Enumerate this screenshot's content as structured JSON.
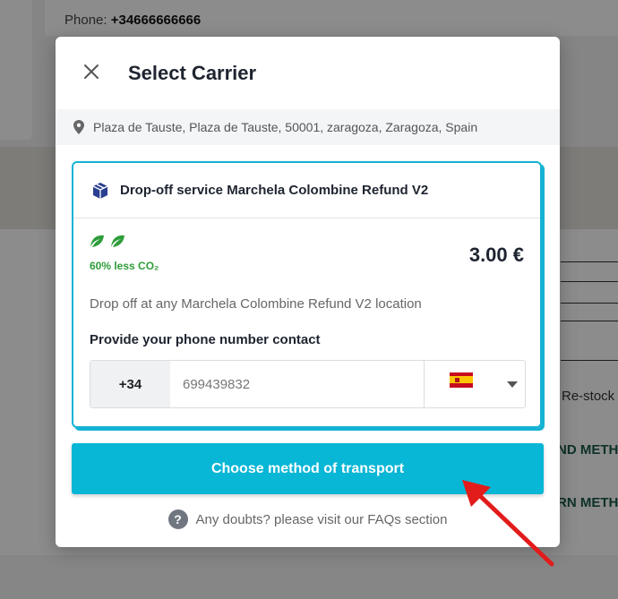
{
  "background": {
    "phone_label": "Phone:",
    "phone_value": "+34666666666",
    "restock_text": "Re-stock",
    "method_text_1": "ND METHO",
    "method_text_2": "RN METHO"
  },
  "modal": {
    "title": "Select Carrier",
    "close_icon": "close-icon",
    "address": "Plaza de Tauste, Plaza de Tauste, 50001, zaragoza, Zaragoza, Spain",
    "carrier": {
      "name": "Drop-off service Marchela Colombine Refund V2",
      "eco_text": "60% less CO₂",
      "price": "3.00 €",
      "description": "Drop off at any Marchela Colombine Refund V2 location",
      "phone_label": "Provide your phone number contact",
      "phone_prefix": "+34",
      "phone_value": "699439832",
      "country_flag": "spain-flag-icon"
    },
    "primary_button": "Choose method of transport",
    "faq_text": "Any doubts? please visit our FAQs section"
  },
  "colors": {
    "accent": "#08b6d6",
    "eco_green": "#2e9d3a",
    "arrow_red": "#e21b1b"
  }
}
